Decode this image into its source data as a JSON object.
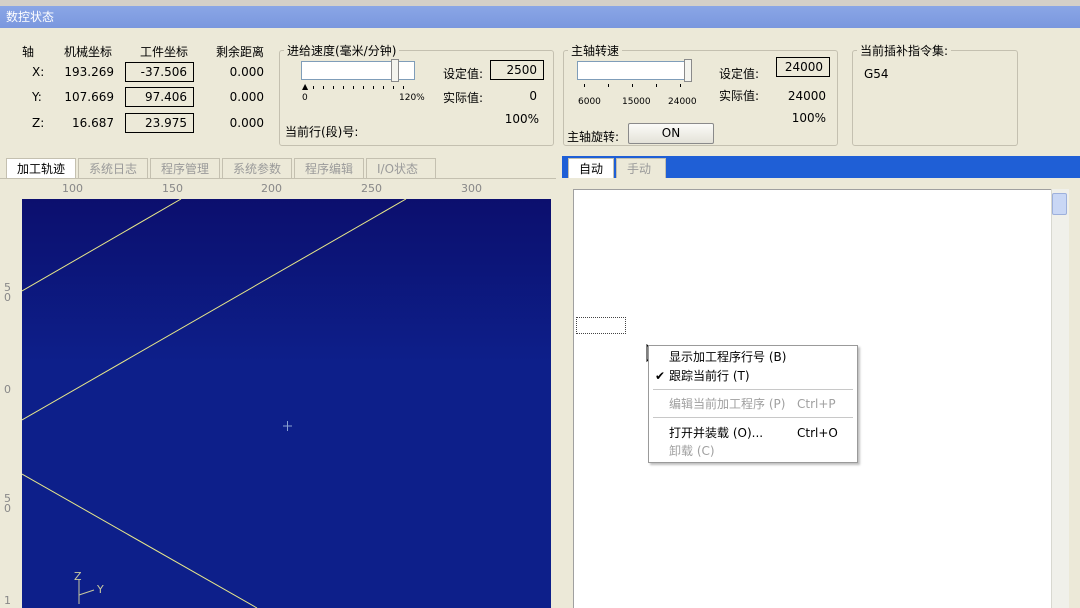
{
  "window_title": "数控状态",
  "axes_panel": {
    "headers": {
      "axis": "轴",
      "machine": "机械坐标",
      "work": "工件坐标",
      "remaining": "剩余距离"
    },
    "rows": [
      {
        "axis": "X:",
        "machine": "193.269",
        "work": "-37.506",
        "remaining": "0.000"
      },
      {
        "axis": "Y:",
        "machine": "107.669",
        "work": "97.406",
        "remaining": "0.000"
      },
      {
        "axis": "Z:",
        "machine": "16.687",
        "work": "23.975",
        "remaining": "0.000"
      }
    ]
  },
  "feed_panel": {
    "title": "进给速度(毫米/分钟)",
    "scale_min": "0",
    "scale_max": "120%",
    "setpoint_label": "设定值:",
    "setpoint_value": "2500",
    "actual_label": "实际值:",
    "actual_value": "0",
    "percent": "100%",
    "current_line_label": "当前行(段)号:",
    "slider_level_pct": 100
  },
  "spindle_panel": {
    "title": "主轴转速",
    "scale": [
      "6000",
      "15000",
      "24000"
    ],
    "setpoint_label": "设定值:",
    "setpoint_value": "24000",
    "actual_label": "实际值:",
    "actual_value": "24000",
    "percent": "100%",
    "rotation_label": "主轴旋转:",
    "rotation_button": "ON"
  },
  "interp_panel": {
    "title": "当前插补指令集:",
    "value": "G54"
  },
  "left_tabs": [
    "加工轨迹",
    "系统日志",
    "程序管理",
    "系统参数",
    "程序编辑",
    "I/O状态"
  ],
  "right_tabs": [
    "自动",
    "手动"
  ],
  "ruler": {
    "x_ticks": [
      "100",
      "150",
      "200",
      "250",
      "300"
    ],
    "y_ticks": [
      "5\n0",
      "0",
      "5\n0",
      "1"
    ]
  },
  "axis_indicator": {
    "z": "Z",
    "y": "Y"
  },
  "context_menu": {
    "items": [
      {
        "label": "显示加工程序行号",
        "key": "(B)",
        "shortcut": "",
        "checked": false,
        "disabled": false
      },
      {
        "label": "跟踪当前行",
        "key": "(T)",
        "shortcut": "",
        "checked": true,
        "disabled": false
      },
      {
        "label": "编辑当前加工程序",
        "key": "(P)",
        "shortcut": "Ctrl+P",
        "checked": false,
        "disabled": true
      },
      {
        "label": "打开并装载",
        "key": "(O)...",
        "shortcut": "Ctrl+O",
        "checked": false,
        "disabled": false
      },
      {
        "label": "卸载",
        "key": "(C)",
        "shortcut": "",
        "checked": false,
        "disabled": true
      }
    ]
  },
  "colors": {
    "title_bar": "#7a97de",
    "plot_bg": "#0d1f8a",
    "toolpath": "#e8e88a",
    "tab_blue": "#1f5fd6"
  }
}
